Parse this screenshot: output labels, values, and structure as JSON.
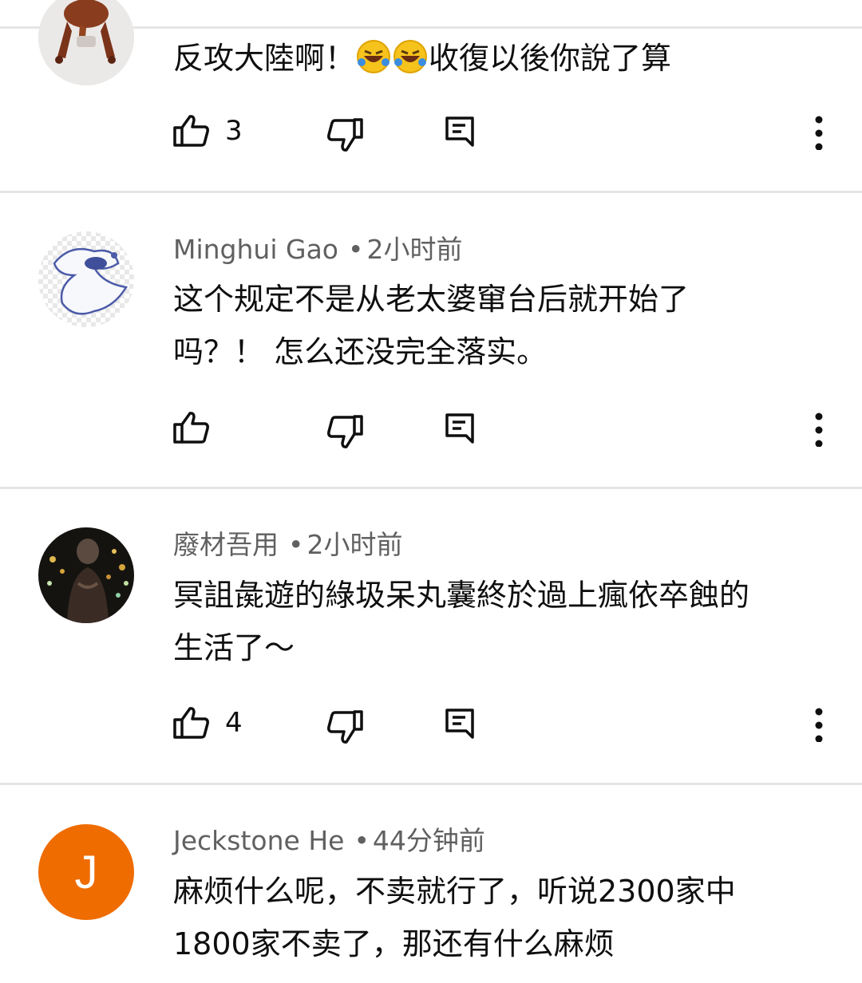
{
  "comments": [
    {
      "author": "",
      "time": "",
      "text_parts": [
        "反攻大陸啊！",
        "收復以後你說了算"
      ],
      "emoji": [
        "rolling-on-floor-laughing",
        "rolling-on-floor-laughing"
      ],
      "likes": "3",
      "avatar": "frog-figurine"
    },
    {
      "author": "Minghui Gao",
      "time": "2小时前",
      "lines": [
        "这个规定不是从老太婆窜台后就开始了",
        "吗？！ 怎么还没完全落实。"
      ],
      "likes": "",
      "avatar": "white-bird-character"
    },
    {
      "author": "廢材吾用",
      "time": "2小时前",
      "lines": [
        "冥詛彘遊的綠圾呆丸囊終於過上瘋依卒蝕的",
        "生活了～"
      ],
      "likes": "4",
      "avatar": "person-night-bokeh"
    },
    {
      "author": "Jeckstone He",
      "time": "44分钟前",
      "lines": [
        "麻烦什么呢，不卖就行了，听说2300家中",
        "1800家不卖了，那还有什么麻烦"
      ],
      "likes": "",
      "avatar": "letter",
      "avatar_letter": "J",
      "avatar_color": "#ef6c00"
    }
  ],
  "icons": {
    "like": "thumbs-up-icon",
    "dislike": "thumbs-down-icon",
    "reply": "reply-comment-icon",
    "more": "more-vertical-icon"
  },
  "colors": {
    "meta_text": "#606060",
    "body_text": "#0f0f0f",
    "divider": "#e5e5e5"
  }
}
